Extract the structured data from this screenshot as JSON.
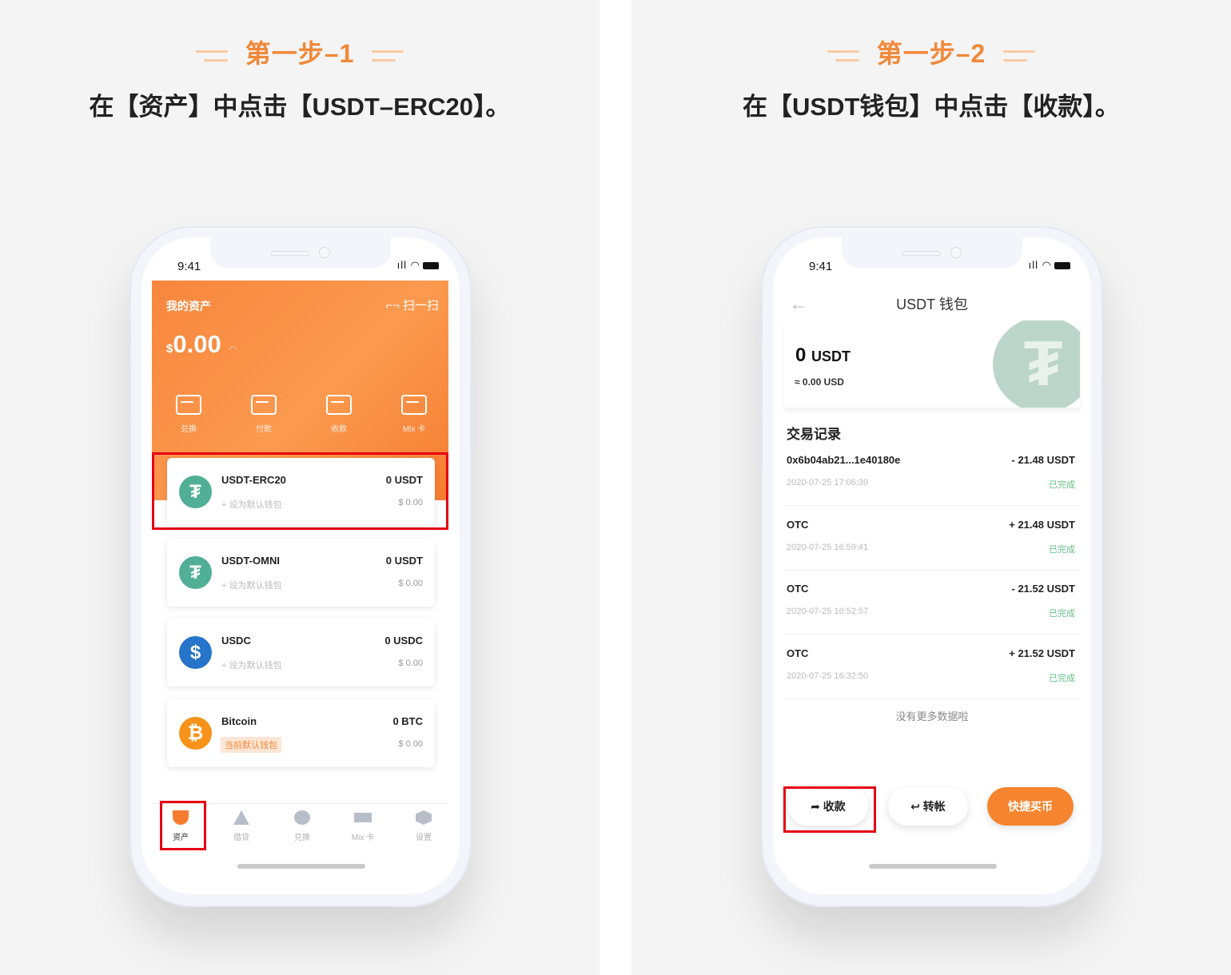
{
  "left": {
    "step_title": "第一步–1",
    "instruction": "在【资产】中点击【USDT–ERC20】。",
    "phone": {
      "time": "9:41",
      "status": "ıll ◠",
      "header": {
        "title": "我的资产",
        "scan_label": "⌐¬ 扫一扫",
        "currency_symbol": "$",
        "balance": "0.00",
        "eye_icon": "◠"
      },
      "actions": [
        {
          "label": "兑换",
          "icon": "exchange-icon"
        },
        {
          "label": "付款",
          "icon": "pay-icon"
        },
        {
          "label": "收款",
          "icon": "receive-icon"
        },
        {
          "label": "Mix 卡",
          "icon": "card-icon"
        }
      ],
      "wallets": [
        {
          "name": "USDT-ERC20",
          "sub": "+ 设为默认钱包",
          "amount": "0 USDT",
          "usd": "$ 0.00",
          "glyph": "₮",
          "color": "#50af95"
        },
        {
          "name": "USDT-OMNI",
          "sub": "+ 设为默认钱包",
          "amount": "0 USDT",
          "usd": "$ 0.00",
          "glyph": "₮",
          "color": "#50af95"
        },
        {
          "name": "USDC",
          "sub": "+ 设为默认钱包",
          "amount": "0 USDC",
          "usd": "$ 0.00",
          "glyph": "$",
          "color": "#2775ca"
        },
        {
          "name": "Bitcoin",
          "sub": "当前默认钱包",
          "amount": "0 BTC",
          "usd": "$ 0.00",
          "glyph": "₿",
          "color": "#f7931a"
        }
      ],
      "tabs": [
        {
          "label": "资产",
          "icon": "gem-icon",
          "active": true
        },
        {
          "label": "借贷",
          "icon": "triangle-icon"
        },
        {
          "label": "兑换",
          "icon": "circle-icon"
        },
        {
          "label": "Mix 卡",
          "icon": "card-icon"
        },
        {
          "label": "设置",
          "icon": "hexagon-icon"
        }
      ]
    }
  },
  "right": {
    "step_title": "第一步–2",
    "instruction": "在【USDT钱包】中点击【收款】。",
    "phone": {
      "time": "9:41",
      "status": "ıll ◠",
      "back_icon": "←",
      "title": "USDT 钱包",
      "balance": "0",
      "balance_unit": "USDT",
      "balance_usd": "≈ 0.00 USD",
      "tether_glyph": "₮",
      "section_title": "交易记录",
      "transactions": [
        {
          "id": "0x6b04ab21...1e40180e",
          "date": "2020-07-25 17:06:39",
          "amount": "- 21.48 USDT",
          "status": "已完成"
        },
        {
          "id": "OTC",
          "date": "2020-07-25 16:59:41",
          "amount": "+ 21.48 USDT",
          "status": "已完成"
        },
        {
          "id": "OTC",
          "date": "2020-07-25 16:52:57",
          "amount": "- 21.52 USDT",
          "status": "已完成"
        },
        {
          "id": "OTC",
          "date": "2020-07-25 16:32:50",
          "amount": "+ 21.52 USDT",
          "status": "已完成"
        }
      ],
      "no_more": "没有更多数据啦",
      "buttons": {
        "receive": "➦ 收款",
        "transfer": "↩ 转帐",
        "buy": "快捷买币"
      }
    }
  },
  "colors": {
    "accent": "#f0893a",
    "highlight": "#e60012",
    "success": "#62c084"
  }
}
